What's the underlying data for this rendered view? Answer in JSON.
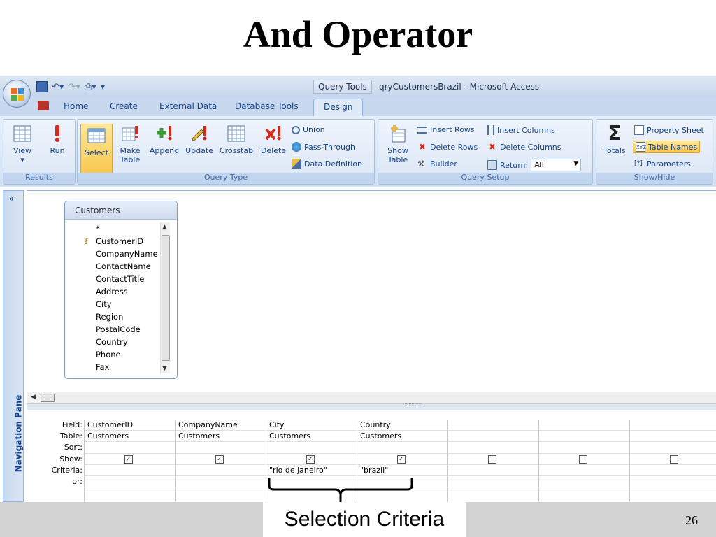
{
  "slide": {
    "title": "And Operator",
    "page_number": "26",
    "callout": "Selection Criteria"
  },
  "app": {
    "context_tab": "Query Tools",
    "window_title": "qryCustomersBrazil - Microsoft Access",
    "tabs": [
      "Home",
      "Create",
      "External Data",
      "Database Tools",
      "Design"
    ],
    "active_tab": "Design"
  },
  "ribbon": {
    "results": {
      "label": "Results",
      "view": "View",
      "run": "Run"
    },
    "query_type": {
      "label": "Query Type",
      "select": "Select",
      "make_table": "Make Table",
      "append": "Append",
      "update": "Update",
      "crosstab": "Crosstab",
      "delete": "Delete",
      "union": "Union",
      "pass_through": "Pass-Through",
      "data_definition": "Data Definition"
    },
    "query_setup": {
      "label": "Query Setup",
      "show_table": "Show Table",
      "insert_rows": "Insert Rows",
      "delete_rows": "Delete Rows",
      "builder": "Builder",
      "insert_columns": "Insert Columns",
      "delete_columns": "Delete Columns",
      "return_label": "Return:",
      "return_value": "All"
    },
    "show_hide": {
      "label": "Show/Hide",
      "totals": "Totals",
      "property_sheet": "Property Sheet",
      "table_names": "Table Names",
      "parameters": "Parameters"
    }
  },
  "nav_pane": {
    "label": "Navigation Pane",
    "toggle": "»"
  },
  "table": {
    "name": "Customers",
    "fields": [
      "*",
      "CustomerID",
      "CompanyName",
      "ContactName",
      "ContactTitle",
      "Address",
      "City",
      "Region",
      "PostalCode",
      "Country",
      "Phone",
      "Fax"
    ]
  },
  "grid": {
    "row_labels": [
      "Field:",
      "Table:",
      "Sort:",
      "Show:",
      "Criteria:",
      "or:"
    ],
    "columns": [
      {
        "field": "CustomerID",
        "table": "Customers",
        "sort": "",
        "show": true,
        "criteria": "",
        "or": ""
      },
      {
        "field": "CompanyName",
        "table": "Customers",
        "sort": "",
        "show": true,
        "criteria": "",
        "or": ""
      },
      {
        "field": "City",
        "table": "Customers",
        "sort": "",
        "show": true,
        "criteria": "\"rio de janeiro\"",
        "or": ""
      },
      {
        "field": "Country",
        "table": "Customers",
        "sort": "",
        "show": true,
        "criteria": "\"brazil\"",
        "or": ""
      },
      {
        "field": "",
        "table": "",
        "sort": "",
        "show": false,
        "criteria": "",
        "or": ""
      },
      {
        "field": "",
        "table": "",
        "sort": "",
        "show": false,
        "criteria": "",
        "or": ""
      },
      {
        "field": "",
        "table": "",
        "sort": "",
        "show": false,
        "criteria": "",
        "or": ""
      }
    ]
  },
  "colors": {
    "ribbon": "#dbe6f5",
    "accent": "#15428b",
    "highlight": "#f9c74f"
  }
}
